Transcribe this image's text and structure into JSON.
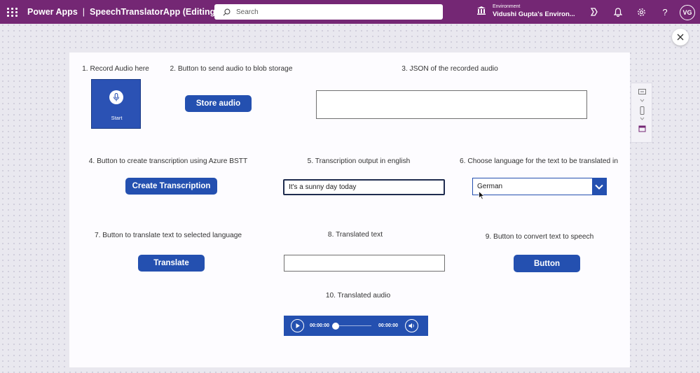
{
  "topbar": {
    "app_name": "Power Apps",
    "separator": "|",
    "app_title": "SpeechTranslatorApp (Editing)",
    "search_placeholder": "Search",
    "environment_label": "Environment",
    "environment_name": "Vidushi Gupta's Environ...",
    "user_initials": "VG",
    "icons": [
      "waffle-icon",
      "search-icon",
      "environment-icon",
      "copilot-icon",
      "bell-icon",
      "gear-icon",
      "help-icon",
      "close-icon"
    ],
    "brand_color": "#742774"
  },
  "canvas": {
    "accent_color": "#2450b0",
    "labels": {
      "record": "1. Record Audio here",
      "store": "2. Button to send audio to blob storage",
      "json": "3. JSON of the recorded audio",
      "transcribe": "4. Button to create transcription using Azure BSTT",
      "transcription_output": "5. Transcription output in english",
      "choose_lang": "6. Choose language for the text to be translated in",
      "translate": "7. Button to translate text to selected language",
      "translated_text": "8. Translated text",
      "tts": "9. Button to convert text to speech",
      "translated_audio": "10. Translated audio"
    },
    "mic": {
      "start_label": "Start"
    },
    "buttons": {
      "store_audio": "Store audio",
      "create_transcription": "Create Transcription",
      "translate": "Translate",
      "tts": "Button"
    },
    "json_box_value": "",
    "transcription_value": "It's a sunny day today",
    "language_selected": "German",
    "translated_text_value": "",
    "audio": {
      "current_time": "00:00:00",
      "duration": "00:00:00",
      "progress": 0
    }
  }
}
